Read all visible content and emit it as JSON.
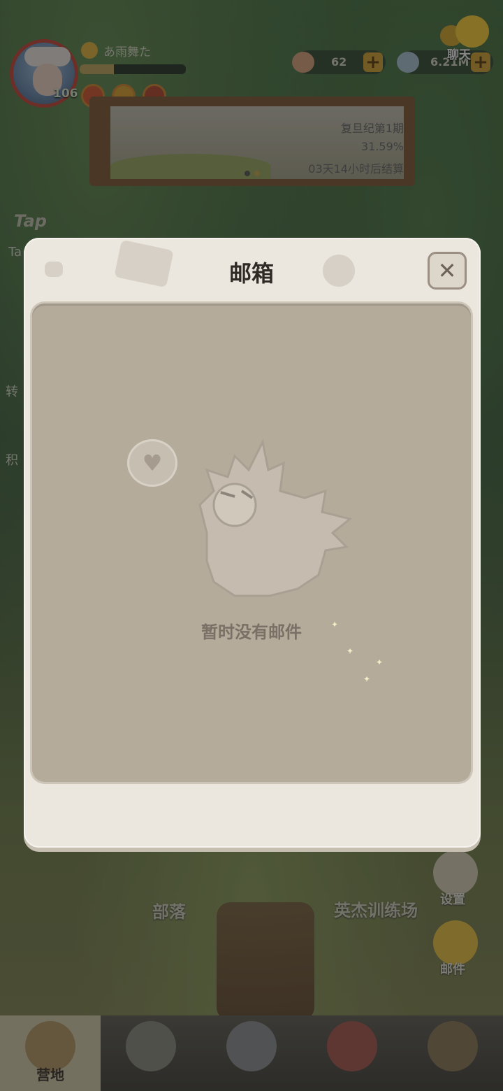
{
  "player": {
    "name": "あ雨舞た",
    "level": "106",
    "exp_fraction": 0.32
  },
  "resources": [
    {
      "icon": "shell-icon",
      "value": "62"
    },
    {
      "icon": "pearl-icon",
      "value": "6.21M"
    }
  ],
  "chat": {
    "label": "聊天"
  },
  "event_banner": {
    "title": "复旦纪第1期",
    "progress": "31.59%",
    "countdown": "03天14小时后结算"
  },
  "side_menu": {
    "tap_label": "Tap",
    "tap_sub": "Ta",
    "item1": "转",
    "item2": "积"
  },
  "scene": {
    "tribe_label": "部落",
    "training_label": "英杰训练场",
    "settings_label": "设置",
    "mail_label": "邮件"
  },
  "bottom_nav": [
    {
      "label": "营地",
      "active": true,
      "icon": "camp-icon"
    },
    {
      "label": "",
      "active": false,
      "icon": "hero-icon"
    },
    {
      "label": "",
      "active": false,
      "icon": "battle-icon"
    },
    {
      "label": "",
      "active": false,
      "icon": "pet-icon"
    },
    {
      "label": "",
      "active": false,
      "icon": "totem-icon"
    }
  ],
  "mailbox": {
    "title": "邮箱",
    "close": "✕",
    "empty_text": "暂时没有邮件"
  },
  "colors": {
    "accent": "#d3a22d",
    "modal_bg": "#ebe6de",
    "panel_bg": "#b5ab9b"
  }
}
